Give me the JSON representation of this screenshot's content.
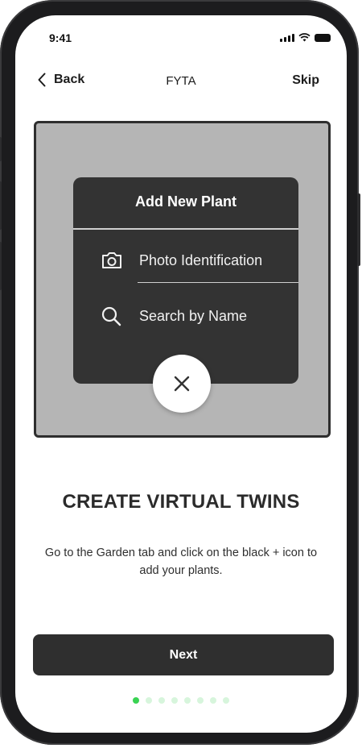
{
  "status_bar": {
    "time": "9:41"
  },
  "nav": {
    "back_label": "Back",
    "title": "FYTA",
    "skip_label": "Skip"
  },
  "illustration": {
    "card_title": "Add New Plant",
    "options": [
      {
        "icon": "camera-icon",
        "label": "Photo Identification"
      },
      {
        "icon": "search-icon",
        "label": "Search by Name"
      }
    ],
    "close_icon": "close-icon"
  },
  "onboarding": {
    "heading": "CREATE VIRTUAL TWINS",
    "description": "Go to the Garden tab and click on the black + icon to add your plants."
  },
  "next_label": "Next",
  "pagination": {
    "total": 8,
    "current": 1
  },
  "colors": {
    "active_dot": "#39d353",
    "inactive_dot": "#d7f5dc",
    "button": "#2f2f2f",
    "card": "#333333"
  }
}
